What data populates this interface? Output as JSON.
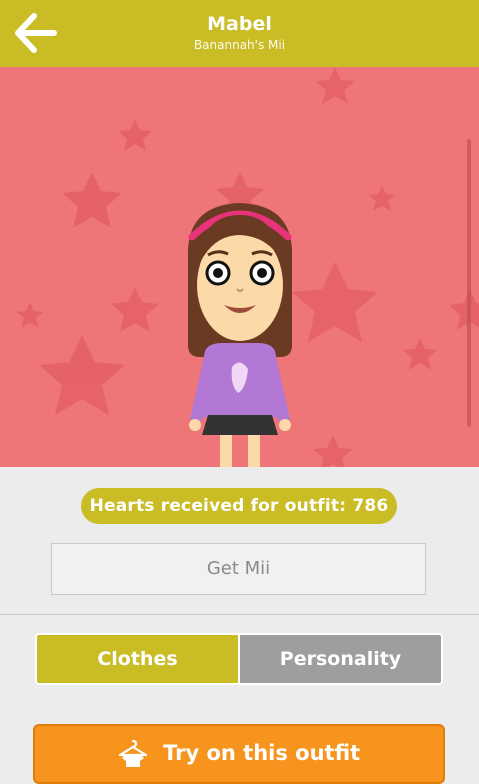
{
  "header": {
    "title": "Mabel",
    "subtitle": "Banannah's Mii",
    "back_icon": "arrow-left-icon"
  },
  "hearts": {
    "label": "Hearts received for outfit: 786"
  },
  "get_mii": {
    "label": "Get Mii"
  },
  "tabs": [
    {
      "label": "Clothes",
      "active": true
    },
    {
      "label": "Personality",
      "active": false
    }
  ],
  "try_on": {
    "label": "Try on this outfit",
    "icon": "hanger-shirt-icon"
  },
  "colors": {
    "accent": "#c9bc24",
    "stage_bg": "#ee7678",
    "star": "#e05c60",
    "button_orange": "#f7941d",
    "tab_inactive": "#9e9e9e"
  }
}
